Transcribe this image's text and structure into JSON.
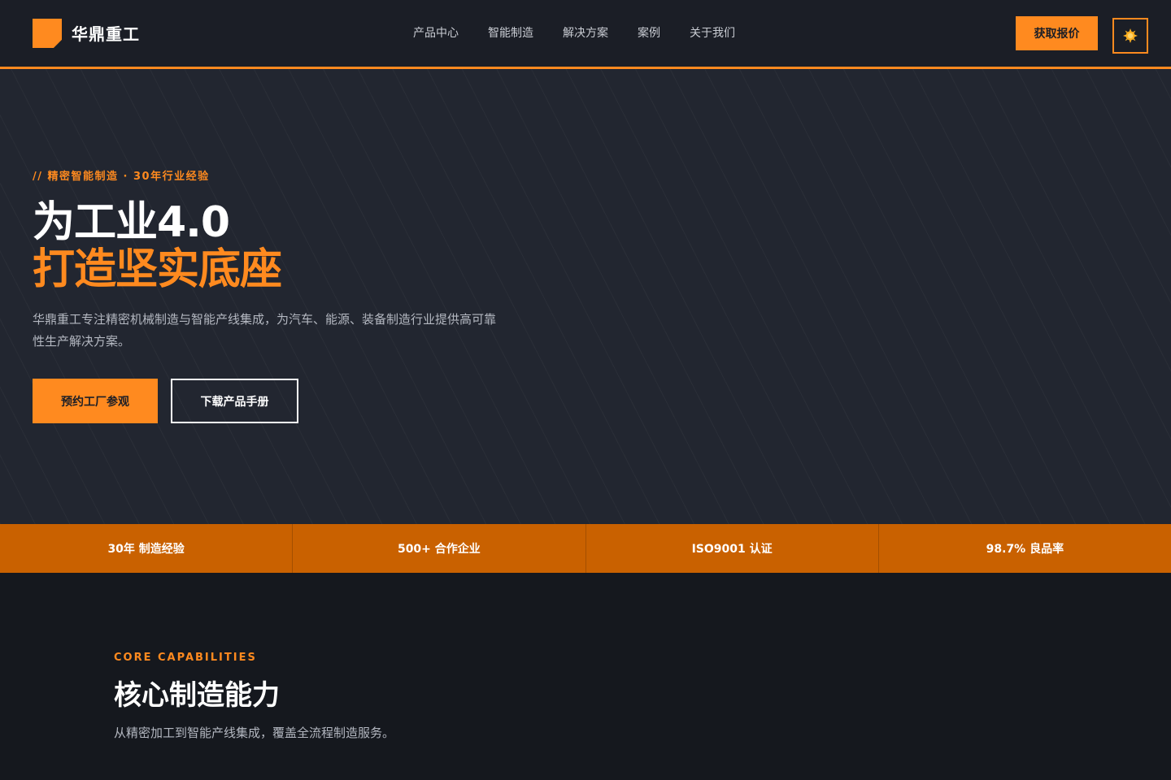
{
  "colors": {
    "accent": "#ff8a1f",
    "header_bg": "#1b1e26",
    "hero_bg": "#222630",
    "stats_bg": "#c96100",
    "section_bg": "#15181e"
  },
  "header": {
    "logo_icon": "brand-square-icon",
    "brand": "华鼎重工",
    "nav": [
      "产品中心",
      "智能制造",
      "解决方案",
      "案例",
      "关于我们"
    ],
    "quote_button": "获取报价",
    "theme_toggle_icon": "sun-icon"
  },
  "hero": {
    "eyebrow": "// 精密智能制造 · 30年行业经验",
    "title_line1": "为工业4.0",
    "title_line2": "打造坚实底座",
    "description": "华鼎重工专注精密机械制造与智能产线集成，为汽车、能源、装备制造行业提供高可靠性生产解决方案。",
    "primary_button": "预约工厂参观",
    "secondary_button": "下载产品手册"
  },
  "stats": [
    "30年 制造经验",
    "500+ 合作企业",
    "ISO9001 认证",
    "98.7% 良品率"
  ],
  "capabilities": {
    "eyebrow": "CORE CAPABILITIES",
    "title": "核心制造能力",
    "description": "从精密加工到智能产线集成，覆盖全流程制造服务。"
  }
}
